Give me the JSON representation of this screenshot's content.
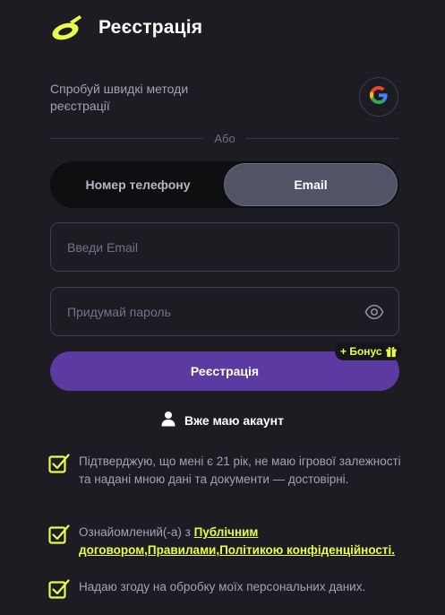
{
  "header": {
    "title": "Реєстрація"
  },
  "quick": {
    "text": "Спробуй швидкі методи реєстрації"
  },
  "divider": {
    "label": "Або"
  },
  "tabs": [
    {
      "label": "Номер телефону",
      "active": false
    },
    {
      "label": "Email",
      "active": true
    }
  ],
  "form": {
    "email_placeholder": "Введи Email",
    "email_value": "",
    "password_placeholder": "Придумай пароль",
    "password_value": "",
    "submit_label": "Реєстрація",
    "bonus_label": "+ Бонус"
  },
  "login": {
    "label": "Вже маю акаунт"
  },
  "consents": [
    {
      "text": "Підтверджую, що мені є 21 рік, не маю ігрової залежності та надані мною дані та документи — достовірні.",
      "checked": true
    },
    {
      "prefix": "Ознайомлений(-а) з ",
      "link": "Публічним договором,Правилами,Політикою конфіденційності.",
      "checked": true
    },
    {
      "text": "Надаю згоду на обробку моїх персональних даних.",
      "checked": true
    }
  ],
  "colors": {
    "background": "#1c1c22",
    "accent_yellow": "#e9fb4b",
    "primary_purple": "#5b3aa2",
    "tab_active": "#505466",
    "muted_text": "#a2a3b3"
  },
  "icons": {
    "logo": "brand-logo",
    "google": "google-icon",
    "eye": "eye-icon",
    "gift": "gift-icon",
    "user": "user-icon",
    "check": "checkmark-icon"
  }
}
